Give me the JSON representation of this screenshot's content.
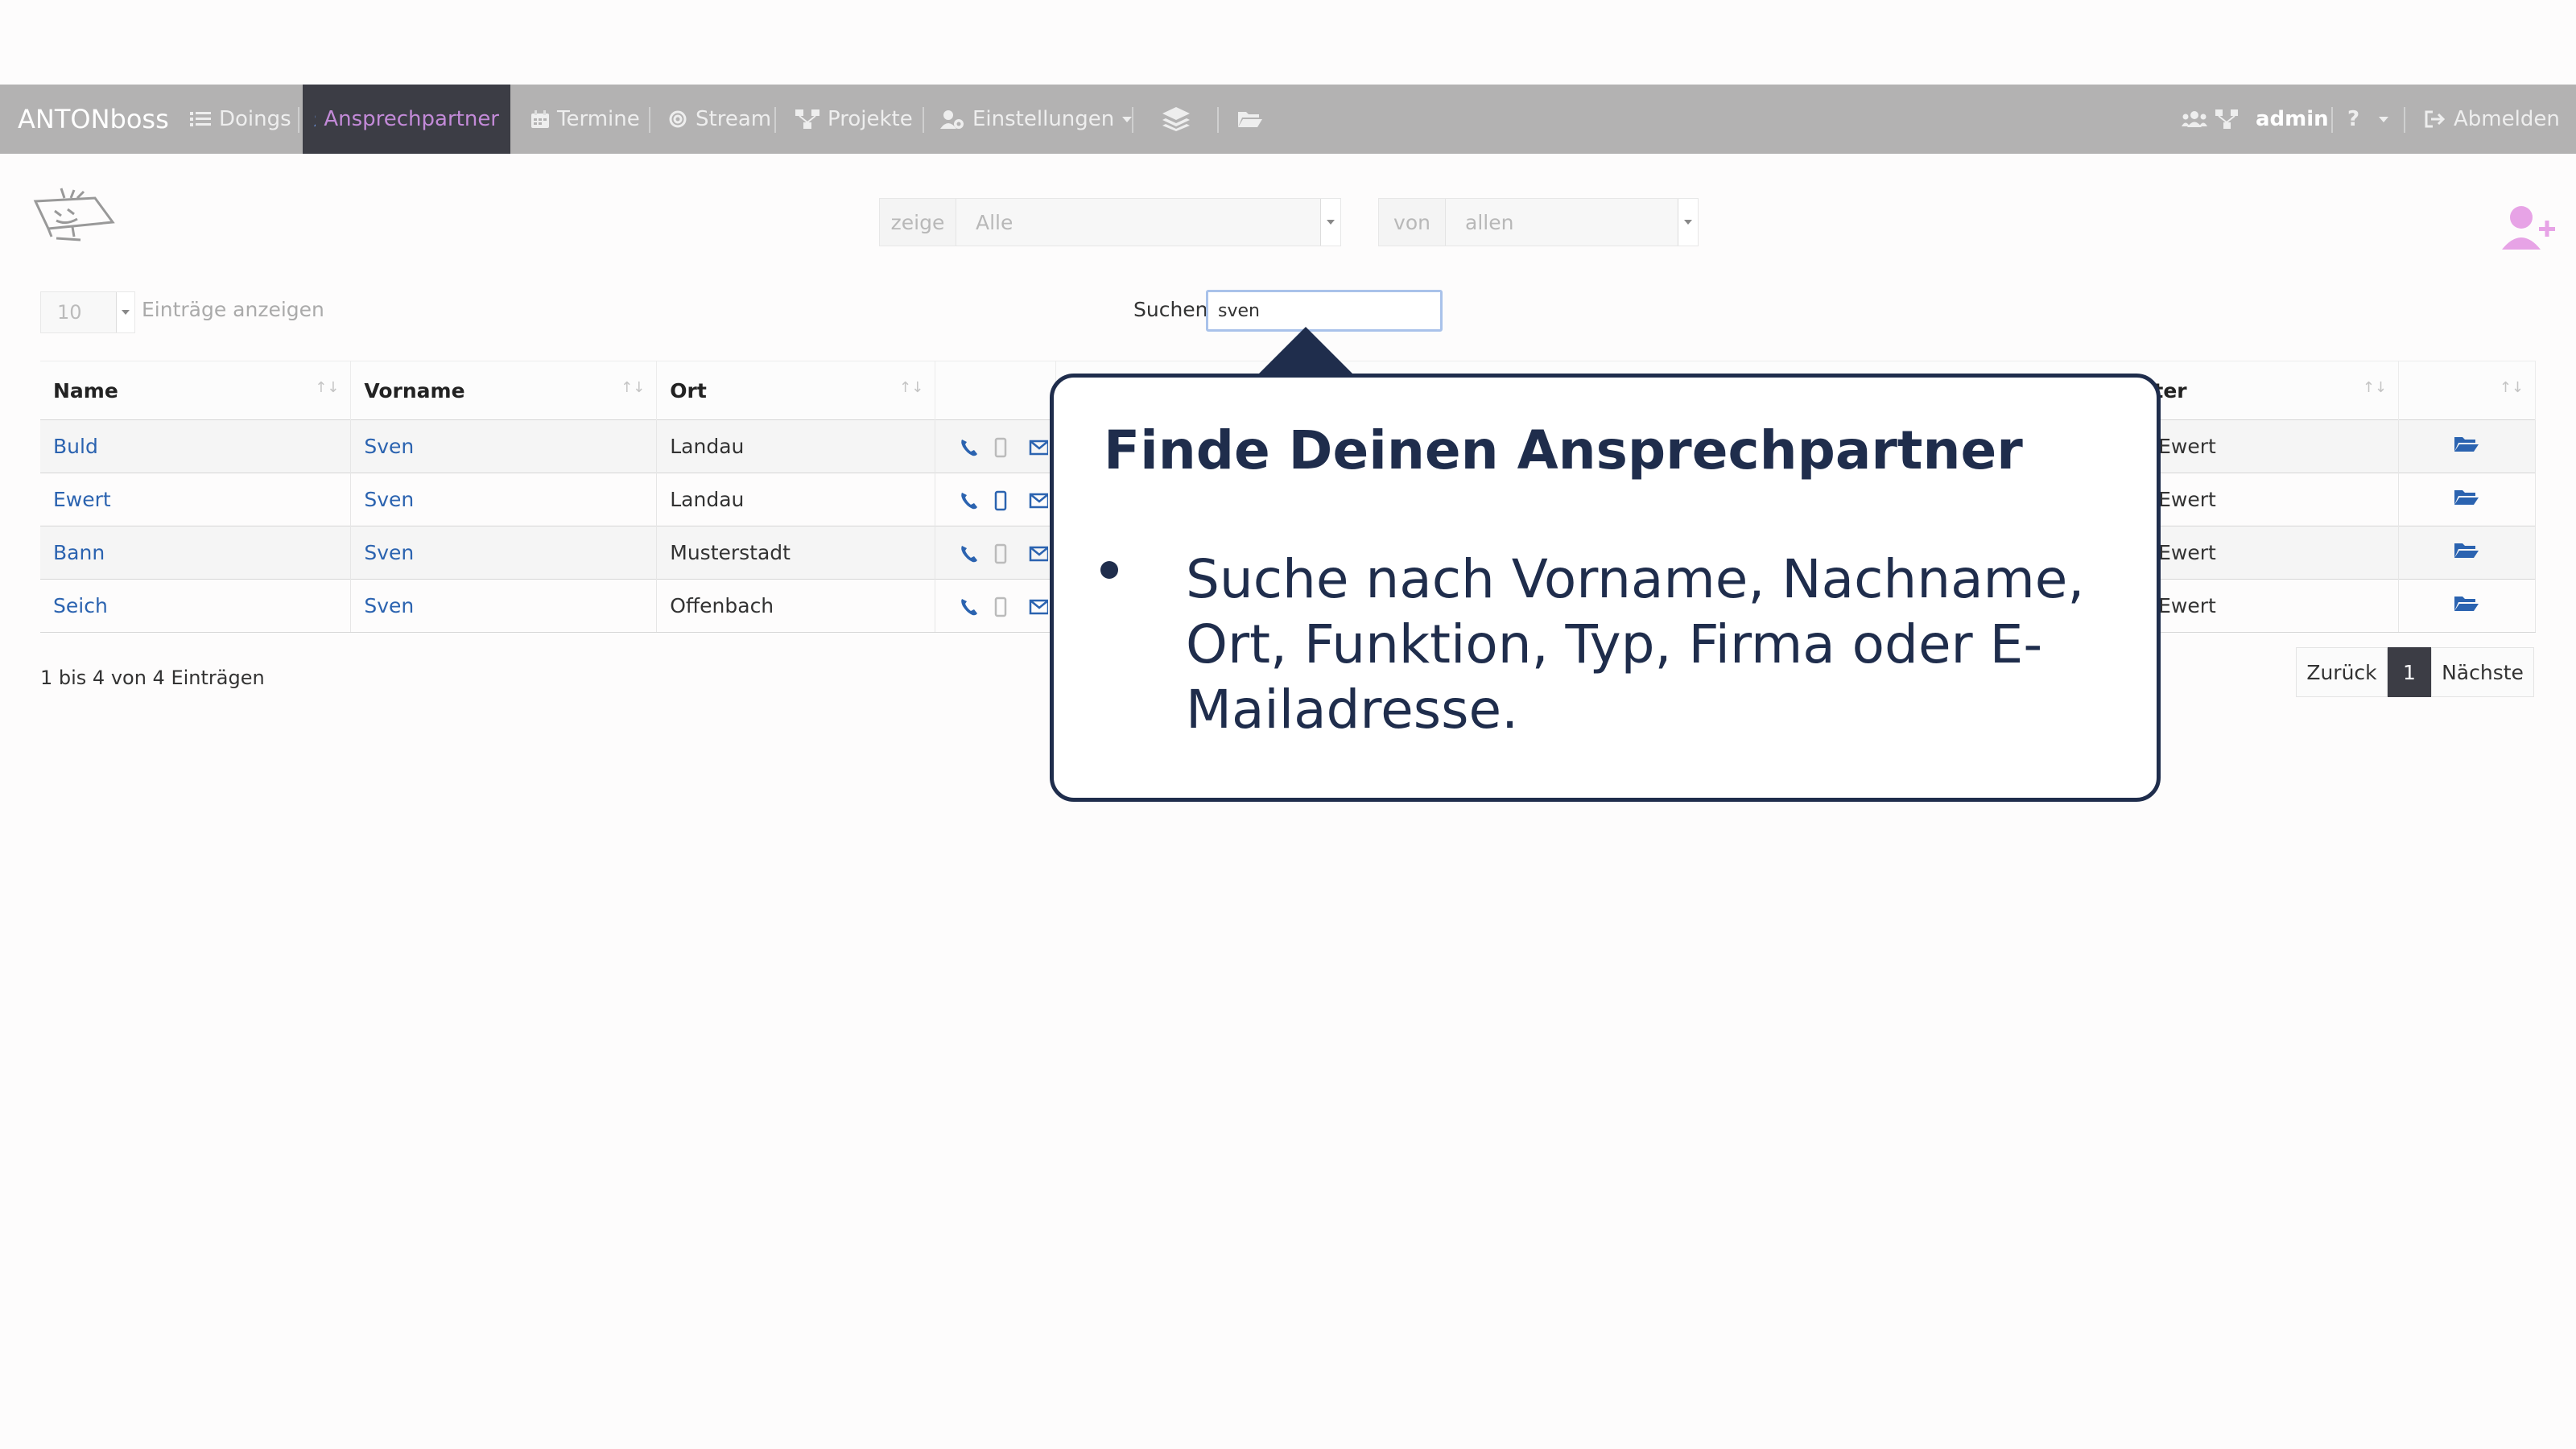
{
  "navbar": {
    "brand": "ANTONboss",
    "items": [
      {
        "label": "Doings",
        "icon": "tasks-icon"
      },
      {
        "label": "Ansprechpartner",
        "icon": "users-icon",
        "active": true
      },
      {
        "label": "Termine",
        "icon": "calendar-icon"
      },
      {
        "label": "Stream",
        "icon": "at-icon"
      },
      {
        "label": "Projekte",
        "icon": "sitemap-icon"
      },
      {
        "label": "Einstellungen",
        "icon": "user-cog-icon"
      }
    ],
    "user": "admin",
    "help": "?",
    "logout": "Abmelden"
  },
  "filters": {
    "show_label": "zeige",
    "show_value": "Alle",
    "from_label": "von",
    "from_value": "allen"
  },
  "entries": {
    "value": "10",
    "label": "Einträge anzeigen"
  },
  "search": {
    "label": "Suchen",
    "value": "sven"
  },
  "table": {
    "headers": [
      "Name",
      "Vorname",
      "Ort",
      "",
      "treter",
      ""
    ],
    "sort_glyph": "↑↓",
    "rows": [
      {
        "name": "Buld",
        "vorname": "Sven",
        "ort": "Landau",
        "vertreter": "nah Ewert"
      },
      {
        "name": "Ewert",
        "vorname": "Sven",
        "ort": "Landau",
        "vertreter": "nah Ewert"
      },
      {
        "name": "Bann",
        "vorname": "Sven",
        "ort": "Musterstadt",
        "vertreter": "nah Ewert"
      },
      {
        "name": "Seich",
        "vorname": "Sven",
        "ort": "Offenbach",
        "vertreter": "nah Ewert"
      }
    ]
  },
  "info": "1 bis 4 von 4 Einträgen",
  "pagination": {
    "prev": "Zurück",
    "current": "1",
    "next": "Nächste"
  },
  "callout": {
    "title": "Finde Deinen Ansprechpartner",
    "bullet": "Suche nach Vorname, Nachname, Ort, Funktion, Typ, Firma oder E-Mailadresse."
  },
  "colors": {
    "navbar": "#b3b2b2",
    "active_tab": "#3c3d45",
    "active_text": "#c38ad8",
    "link": "#2b63b0",
    "callout": "#1f2d4c",
    "add_user": "#e7a3e6"
  }
}
